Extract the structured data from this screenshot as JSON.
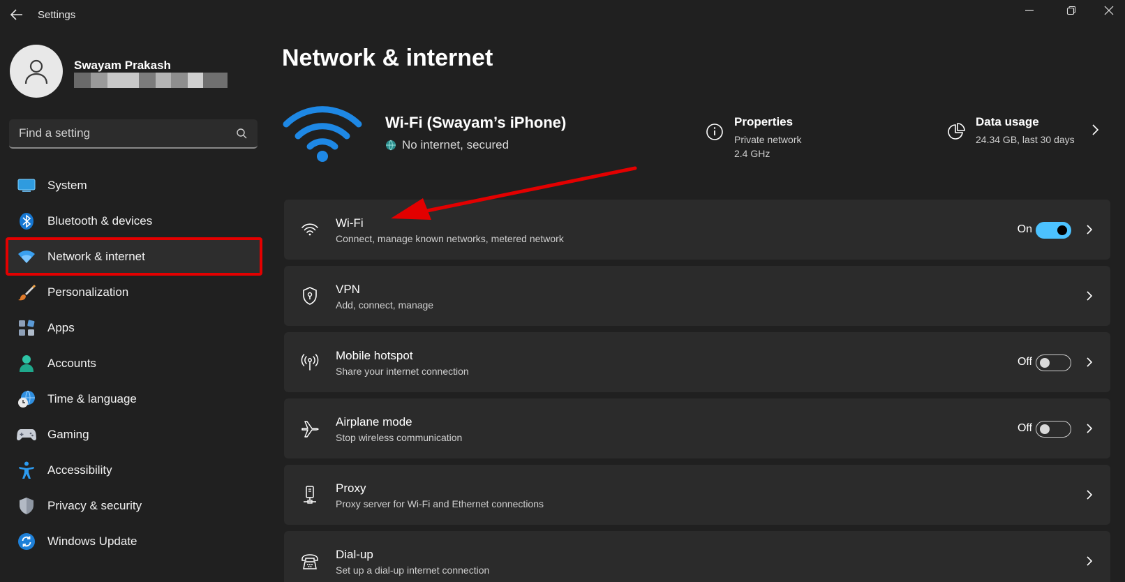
{
  "window": {
    "title": "Settings"
  },
  "profile": {
    "name": "Swayam Prakash",
    "email_redacted": true
  },
  "search": {
    "placeholder": "Find a setting"
  },
  "sidebar": {
    "items": [
      {
        "label": "System",
        "icon": "monitor-icon"
      },
      {
        "label": "Bluetooth & devices",
        "icon": "bluetooth-icon"
      },
      {
        "label": "Network & internet",
        "icon": "wifi-icon",
        "active": true
      },
      {
        "label": "Personalization",
        "icon": "paintbrush-icon"
      },
      {
        "label": "Apps",
        "icon": "apps-icon"
      },
      {
        "label": "Accounts",
        "icon": "person-icon"
      },
      {
        "label": "Time & language",
        "icon": "clock-globe-icon"
      },
      {
        "label": "Gaming",
        "icon": "gamepad-icon"
      },
      {
        "label": "Accessibility",
        "icon": "accessibility-icon"
      },
      {
        "label": "Privacy & security",
        "icon": "shield-icon"
      },
      {
        "label": "Windows Update",
        "icon": "update-icon"
      }
    ]
  },
  "main": {
    "title": "Network & internet",
    "connection": {
      "name": "Wi-Fi (Swayam’s iPhone)",
      "status": "No internet, secured"
    },
    "properties": {
      "title": "Properties",
      "line1": "Private network",
      "line2": "2.4 GHz"
    },
    "data_usage": {
      "title": "Data usage",
      "line1": "24.34 GB, last 30 days"
    },
    "cards": [
      {
        "title": "Wi-Fi",
        "subtitle": "Connect, manage known networks, metered network",
        "state": "On",
        "toggle": true,
        "icon": "wifi-icon"
      },
      {
        "title": "VPN",
        "subtitle": "Add, connect, manage",
        "icon": "vpn-shield-icon"
      },
      {
        "title": "Mobile hotspot",
        "subtitle": "Share your internet connection",
        "state": "Off",
        "toggle": false,
        "icon": "hotspot-icon"
      },
      {
        "title": "Airplane mode",
        "subtitle": "Stop wireless communication",
        "state": "Off",
        "toggle": false,
        "icon": "airplane-icon"
      },
      {
        "title": "Proxy",
        "subtitle": "Proxy server for Wi-Fi and Ethernet connections",
        "icon": "proxy-icon"
      },
      {
        "title": "Dial-up",
        "subtitle": "Set up a dial-up internet connection",
        "icon": "dialup-icon"
      }
    ]
  },
  "colors": {
    "background": "#202020",
    "card": "#2b2b2b",
    "accent": "#4cc2ff",
    "wifi_blue": "#1e88e5",
    "annotation_red": "#e30000"
  }
}
